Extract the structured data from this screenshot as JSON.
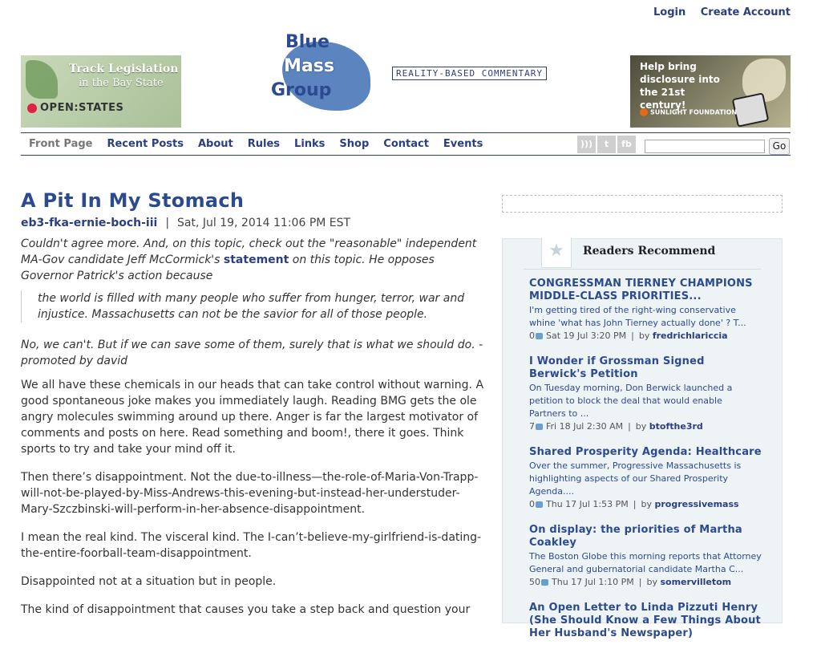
{
  "header": {
    "login": "Login",
    "create_account": "Create Account",
    "tagline": "REALITY-BASED COMMENTARY",
    "logo": {
      "line1": "Blue",
      "line2": "Mass",
      "line3": "Group"
    }
  },
  "ads": {
    "left": {
      "line1": "Track Legislation",
      "line2": "in the Bay State",
      "brand": "OPEN:STATES"
    },
    "right": {
      "text": "Help bring disclosure into the 21st century!",
      "brand": "SUNLIGHT FOUNDATION"
    }
  },
  "nav": {
    "items": [
      "Front Page",
      "Recent Posts",
      "About",
      "Rules",
      "Links",
      "Shop",
      "Contact",
      "Events"
    ],
    "social": [
      "rss-icon",
      "twitter-icon",
      "facebook-icon"
    ],
    "go_label": "Go"
  },
  "article": {
    "title": "A Pit In My Stomach",
    "author": "eb3-fka-ernie-boch-iii",
    "date": "Sat, Jul 19, 2014 11:06 PM EST",
    "intro_before": "Couldn't agree more. And, on this topic, check out the \"reasonable\" independent MA-Gov candidate Jeff McCormick's ",
    "intro_link": "statement",
    "intro_after": " on this topic. He opposes Governor Patrick's action because",
    "quote": "the world is filled with many people who suffer from hunger, terror, war and injustice. Massachusetts can not be the savior for all of those people.",
    "promo": "No, we can't. But if we can save some of them, surely that is what we should do. -promoted by david",
    "paragraphs": [
      "We all have these chemicals in our heads that can take control without warning. A good spontaneous joke makes you immediately laugh. Reading BMG gets the ole angry molecules swimming around up there. Anger is far the largest motivator of comments and posts on here. Read something and boom!, there it goes. Think sports to try and take your mind off it.",
      "Then there’s disappointment. Not the due-to-illness—the-role-of-Maria-Von-Trapp-will-not-be-played-by-Miss-Andrews-this-evening-but-instead-her-understuder-Mary-Szczbinski-will-perform-in-her-absence-disappointment.",
      "I mean the real kind. The visceral kind. The I-can’t-believe-my-girlfriend-is-dating-the-entire-foorball-team-disappointment.",
      "Disappointed not at a situation but in people.",
      "The kind of disappointment that causes you take a step back and question your"
    ]
  },
  "readers_recommend": {
    "heading": "Readers Recommend",
    "items": [
      {
        "title": "CONGRESSMAN TIERNEY CHAMPIONS MIDDLE-CLASS PRIORITIES...",
        "excerpt": "I'm getting tired of the right-wing conservative whine 'what has John Tierney actually done' ? T...",
        "comments": "0",
        "date": "Sat 19 Jul 3:20 PM",
        "by_label": "by",
        "author": "fredrichlariccia"
      },
      {
        "title": "I Wonder if Grossman Signed Berwick's Petition",
        "excerpt": "On Tuesday morning, Don Berwick launched a petition to block the deal that would enable Partners to ...",
        "comments": "7",
        "date": "Fri 18 Jul 2:30 AM",
        "by_label": "by",
        "author": "btofthe3rd"
      },
      {
        "title": "Shared Prosperity Agenda: Healthcare",
        "excerpt": "Over the summer, Progressive Massachusetts is highlighting aspects of our Shared Prosperity Agenda....",
        "comments": "0",
        "date": "Thu 17 Jul 1:53 PM",
        "by_label": "by",
        "author": "progressivemass"
      },
      {
        "title": "On display: the priorities of Martha Coakley",
        "excerpt": "The Boston Globe this morning reports that Attorney General and gubernatorial candidate Martha C...",
        "comments": "50",
        "date": "Thu 17 Jul 1:10 PM",
        "by_label": "by",
        "author": "somervilletom"
      },
      {
        "title": "An Open Letter to Linda Pizzuti Henry (She Should Know a Few Things About Her Husband's Newspaper)",
        "excerpt": "",
        "comments": "",
        "date": "",
        "by_label": "",
        "author": ""
      }
    ]
  }
}
